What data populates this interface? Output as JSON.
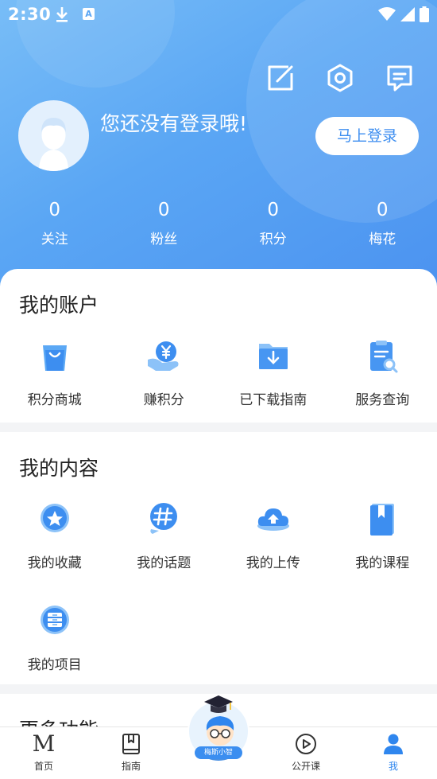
{
  "status_bar": {
    "time": "2:30",
    "icons": [
      "download-icon",
      "text-a-icon",
      "wifi-icon",
      "signal-icon",
      "battery-icon"
    ]
  },
  "header": {
    "actions": [
      "edit-icon",
      "settings-icon",
      "message-icon"
    ],
    "login_prompt": "您还没有登录哦!",
    "login_button": "马上登录"
  },
  "stats": [
    {
      "value": "0",
      "label": "关注"
    },
    {
      "value": "0",
      "label": "粉丝"
    },
    {
      "value": "0",
      "label": "积分"
    },
    {
      "value": "0",
      "label": "梅花"
    }
  ],
  "account": {
    "title": "我的账户",
    "items": [
      {
        "label": "积分商城",
        "icon": "shopping-bag-icon"
      },
      {
        "label": "赚积分",
        "icon": "yen-coin-icon"
      },
      {
        "label": "已下载指南",
        "icon": "download-folder-icon"
      },
      {
        "label": "服务查询",
        "icon": "document-search-icon"
      }
    ]
  },
  "content": {
    "title": "我的内容",
    "items": [
      {
        "label": "我的收藏",
        "icon": "star-icon"
      },
      {
        "label": "我的话题",
        "icon": "hashtag-icon"
      },
      {
        "label": "我的上传",
        "icon": "cloud-upload-icon"
      },
      {
        "label": "我的课程",
        "icon": "bookmark-book-icon"
      },
      {
        "label": "我的项目",
        "icon": "cabinet-icon"
      }
    ]
  },
  "more": {
    "title": "更多功能"
  },
  "tabbar": {
    "tabs": [
      {
        "label": "首页",
        "icon": "m-logo-icon",
        "glyph": "M"
      },
      {
        "label": "指南",
        "icon": "book-icon"
      },
      {
        "label": "公开课",
        "icon": "play-circle-icon"
      },
      {
        "label": "我",
        "icon": "person-icon",
        "active": true
      }
    ],
    "mascot_label": "梅斯小智"
  },
  "colors": {
    "primary": "#4b92f0",
    "hero_light": "#78bdf7",
    "icon_blue": "#3d8ef0",
    "active_tab": "#2f86ee"
  }
}
